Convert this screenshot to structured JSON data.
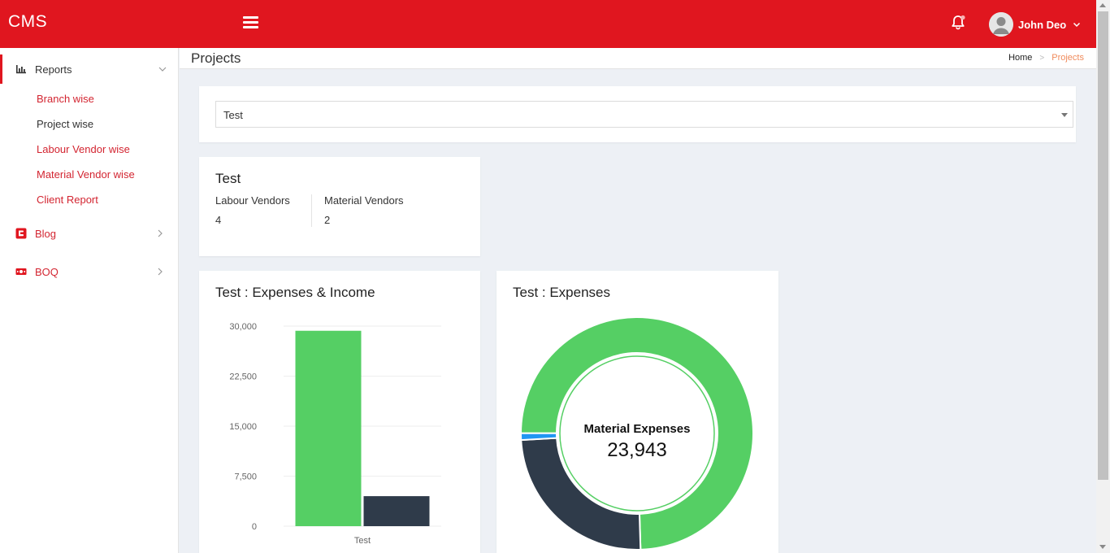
{
  "header": {
    "brand": "CMS",
    "user_name": "John Deo",
    "accent_color": "#e0161f"
  },
  "sidebar": {
    "reports_label": "Reports",
    "reports_sub": [
      "Branch wise",
      "Project wise",
      "Labour Vendor wise",
      "Material Vendor wise",
      "Client Report"
    ],
    "blog_label": "Blog",
    "boq_label": "BOQ"
  },
  "breadcrumb": {
    "page_title": "Projects",
    "home": "Home",
    "separator": ">",
    "current": "Projects"
  },
  "project_select": {
    "value": "Test"
  },
  "project_info": {
    "title": "Test",
    "labour_vendors_label": "Labour Vendors",
    "labour_vendors_value": "4",
    "material_vendors_label": "Material Vendors",
    "material_vendors_value": "2"
  },
  "chart_data": [
    {
      "type": "bar",
      "title": "Test : Expenses & Income",
      "categories": [
        "Test"
      ],
      "series": [
        {
          "color": "#55cf64",
          "values": [
            29300
          ]
        },
        {
          "color": "#2f3b4a",
          "values": [
            4500
          ]
        }
      ],
      "ylim": [
        0,
        30000
      ],
      "yticks": [
        0,
        7500,
        15000,
        22500,
        30000
      ],
      "ytick_labels": [
        "0",
        "7,500",
        "15,000",
        "22,500",
        "30,000"
      ],
      "grid": true
    },
    {
      "type": "pie",
      "title": "Test : Expenses",
      "center_label": "Material Expenses",
      "center_value": "23,943",
      "slices": [
        {
          "value": 23943,
          "color": "#55cf64"
        },
        {
          "value": 7900,
          "color": "#2f3b4a"
        },
        {
          "value": 300,
          "color": "#2196f3"
        }
      ]
    }
  ]
}
